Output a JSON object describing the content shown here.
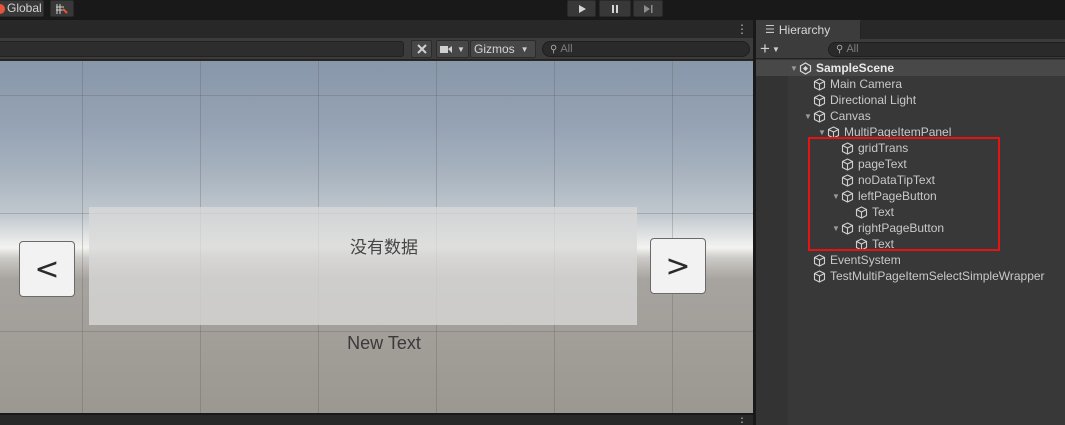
{
  "toolbar": {
    "global_label": "Global",
    "play_icon": "play-icon",
    "pause_icon": "pause-icon",
    "step_icon": "step-icon"
  },
  "scene": {
    "gizmos_label": "Gizmos",
    "search_placeholder": "All",
    "ui_panel_text": "没有数据",
    "page_text": "New Text",
    "left_button_label": "<",
    "right_button_label": ">"
  },
  "hierarchy": {
    "tab_label": "Hierarchy",
    "search_placeholder": "All",
    "scene_name": "SampleScene",
    "items": [
      {
        "label": "Main Camera",
        "depth": 1,
        "expanded": null
      },
      {
        "label": "Directional Light",
        "depth": 1,
        "expanded": null
      },
      {
        "label": "Canvas",
        "depth": 1,
        "expanded": true
      },
      {
        "label": "MultiPageItemPanel",
        "depth": 2,
        "expanded": true
      },
      {
        "label": "gridTrans",
        "depth": 3,
        "expanded": null
      },
      {
        "label": "pageText",
        "depth": 3,
        "expanded": null
      },
      {
        "label": "noDataTipText",
        "depth": 3,
        "expanded": null
      },
      {
        "label": "leftPageButton",
        "depth": 3,
        "expanded": true
      },
      {
        "label": "Text",
        "depth": 4,
        "expanded": null
      },
      {
        "label": "rightPageButton",
        "depth": 3,
        "expanded": true
      },
      {
        "label": "Text",
        "depth": 4,
        "expanded": null
      },
      {
        "label": "EventSystem",
        "depth": 1,
        "expanded": null
      },
      {
        "label": "TestMultiPageItemSelectSimpleWrapper",
        "depth": 1,
        "expanded": null
      }
    ]
  },
  "colors": {
    "highlight": "#e21414",
    "accent_orange": "#e8553e"
  }
}
